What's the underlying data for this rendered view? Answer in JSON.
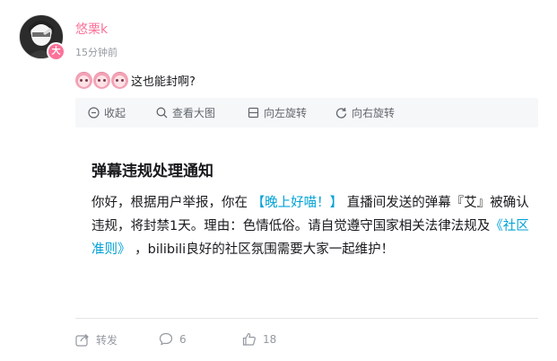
{
  "user": {
    "name": "悠栗k",
    "badge": "大"
  },
  "post": {
    "time": "15分钟前",
    "text": "这也能封啊?",
    "emote_icons": [
      "pink-bunny-emote",
      "pink-bunny-emote",
      "pink-bunny-emote"
    ]
  },
  "toolbar": {
    "collapse": "收起",
    "view_large": "查看大图",
    "rotate_left": "向左旋转",
    "rotate_right": "向右旋转"
  },
  "notice": {
    "title": "弹幕违规处理通知",
    "p1": "你好，根据用户举报，你在 ",
    "room_link": "【晚上好喵！】",
    "p2": " 直播间发送的弹幕『艾』被确认违规，将封禁1天。理由：色情低俗。请自觉遵守国家相关法律法规及",
    "rules_link": "《社区准则》",
    "p3": " ，bilibili良好的社区氛围需要大家一起维护！"
  },
  "actions": {
    "forward": "转发",
    "comments": "6",
    "likes": "18"
  },
  "colors": {
    "accent_pink": "#fb7299",
    "link_blue": "#00a1d6",
    "muted": "#9499a0"
  }
}
